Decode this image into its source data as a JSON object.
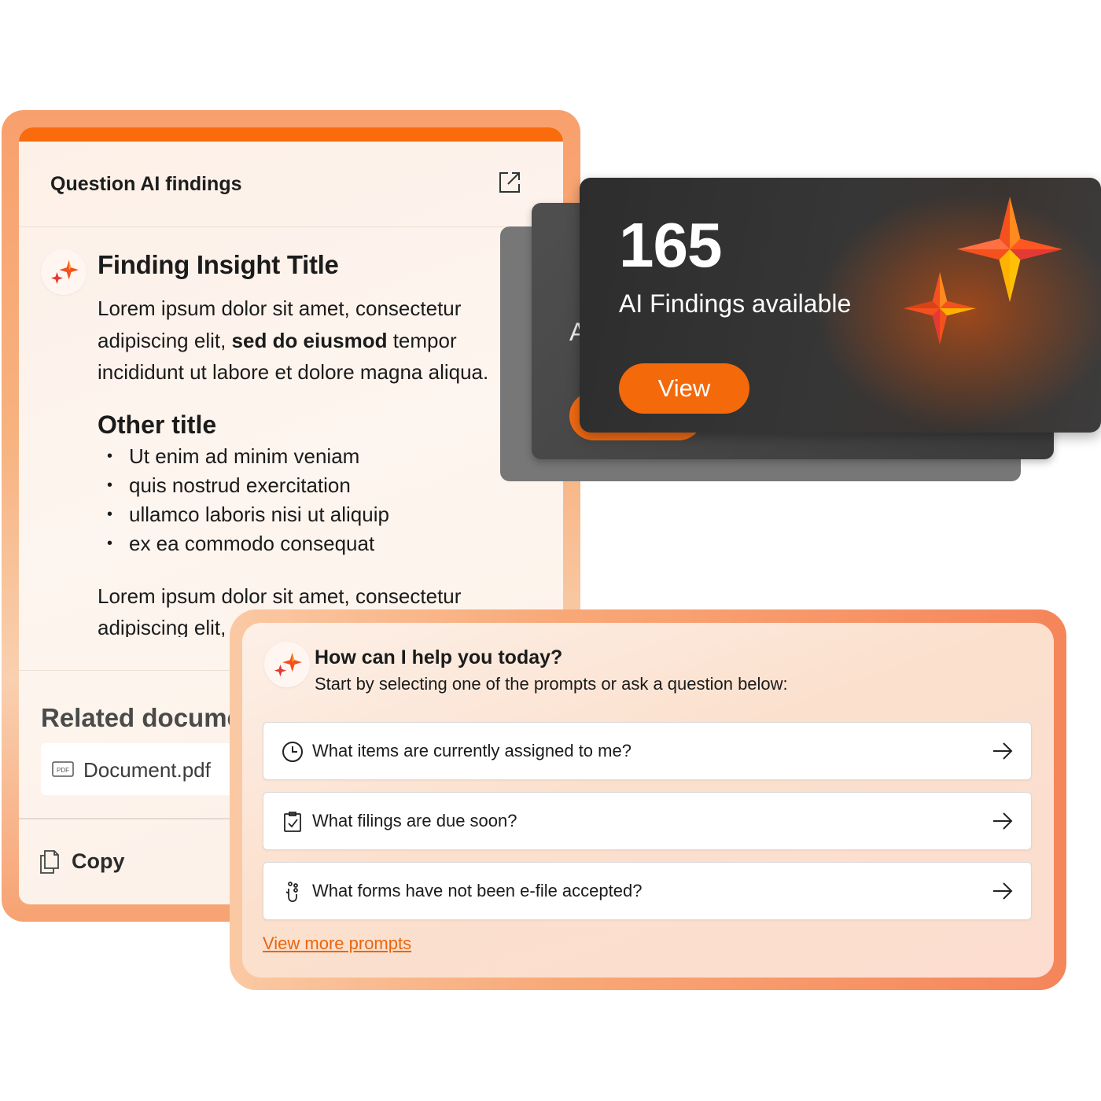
{
  "findings_panel": {
    "header": "Question AI findings",
    "insight_title": "Finding Insight Title",
    "insight_body_1": "Lorem ipsum dolor sit amet, consectetur adipiscing elit, ",
    "insight_body_bold": "sed do eiusmod",
    "insight_body_2": " tempor incididunt ut labore et dolore magna aliqua.",
    "other_title": "Other title",
    "bullets": [
      "Ut enim ad minim veniam",
      "quis nostrud exercitation",
      "ullamco laboris nisi ut aliquip",
      "ex ea commodo consequat"
    ],
    "closing_text": "Lorem ipsum dolor sit amet, consectetur adipiscing elit, sed do eiusmod",
    "related_title": "Related documents",
    "document_name": "Document.pdf",
    "pdf_icon_text": "PDF",
    "copy_label": "Copy"
  },
  "findings_card": {
    "count": "165",
    "subtitle": "AI Findings available",
    "view_label": "View",
    "back_card_letter": "A"
  },
  "help_panel": {
    "title": "How can I help you today?",
    "subtitle": "Start by selecting one of the prompts or ask a question below:",
    "prompts": [
      {
        "label": "What items are currently assigned to me?",
        "icon": "clock-icon"
      },
      {
        "label": "What filings are due soon?",
        "icon": "clipboard-check-icon"
      },
      {
        "label": "What forms have not been e-file accepted?",
        "icon": "hand-icon"
      }
    ],
    "view_more": "View more prompts"
  },
  "colors": {
    "accent": "#f96b0d",
    "card_dark": "#2d2d2d",
    "link": "#e8660e"
  }
}
